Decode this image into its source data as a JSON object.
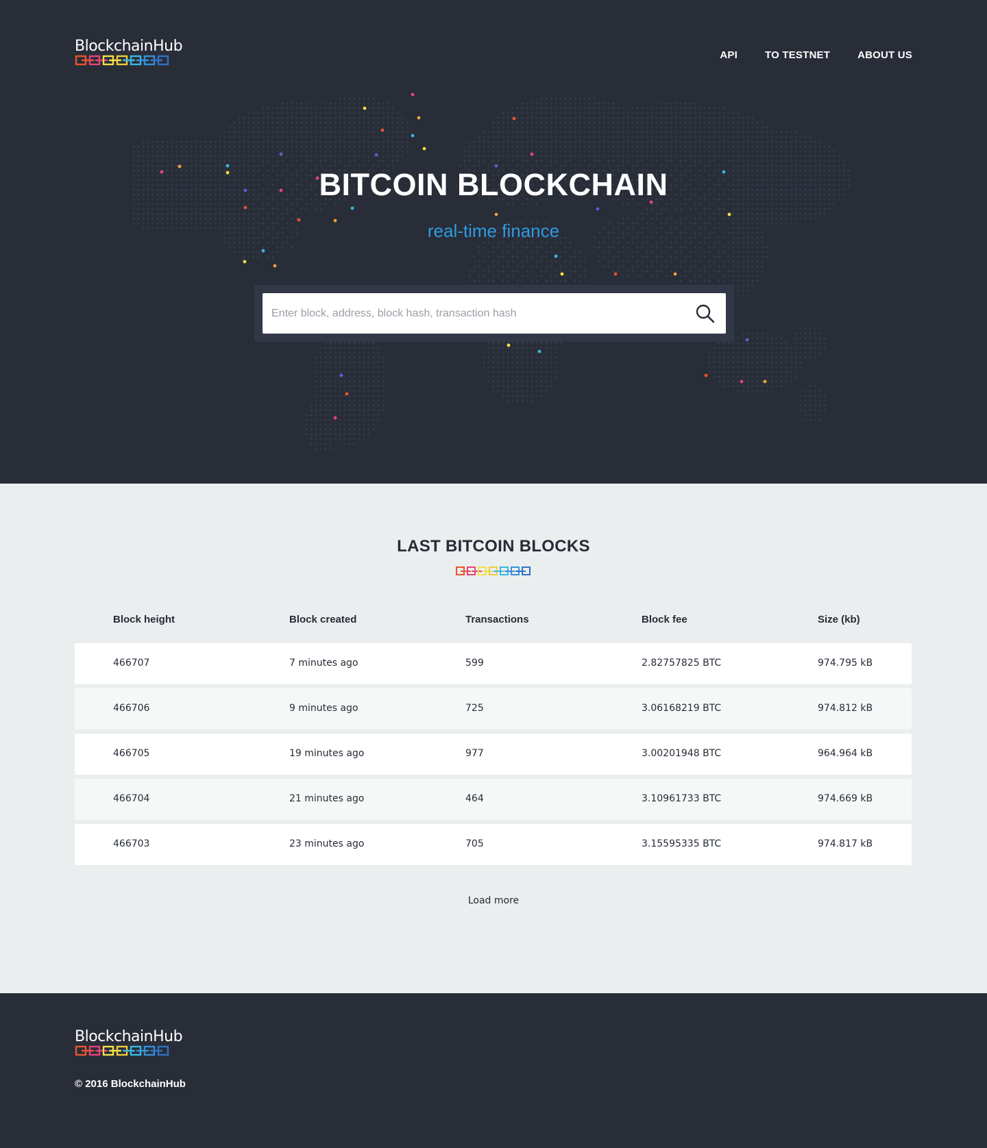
{
  "header": {
    "logo_text": "BlockchainHub",
    "nav": [
      {
        "label": "API"
      },
      {
        "label": "TO TESTNET"
      },
      {
        "label": "ABOUT US"
      }
    ]
  },
  "hero": {
    "title": "BITCOIN BLOCKCHAIN",
    "subtitle": "real-time finance",
    "search_placeholder": "Enter block, address, block hash, transaction hash"
  },
  "blocks": {
    "title": "LAST BITCOIN BLOCKS",
    "columns": [
      "Block height",
      "Block created",
      "Transactions",
      "Block fee",
      "Size (kb)"
    ],
    "rows": [
      [
        "466707",
        "7 minutes ago",
        "599",
        "2.82757825 BTC",
        "974.795 kB"
      ],
      [
        "466706",
        "9 minutes ago",
        "725",
        "3.06168219 BTC",
        "974.812 kB"
      ],
      [
        "466705",
        "19 minutes ago",
        "977",
        "3.00201948 BTC",
        "964.964 kB"
      ],
      [
        "466704",
        "21 minutes ago",
        "464",
        "3.10961733 BTC",
        "974.669 kB"
      ],
      [
        "466703",
        "23 minutes ago",
        "705",
        "3.15595335 BTC",
        "974.817 kB"
      ]
    ],
    "load_more": "Load more"
  },
  "footer": {
    "logo_text": "BlockchainHub",
    "copyright": "© 2016 BlockchainHub"
  },
  "colors": {
    "hero_bg": "#282d38",
    "accent_blue": "#2e9be0",
    "chain": [
      "#e8542f",
      "#e8437a",
      "#f2e246",
      "#f0cd3a",
      "#38b8e0",
      "#3591d9",
      "#2f72c4"
    ]
  }
}
